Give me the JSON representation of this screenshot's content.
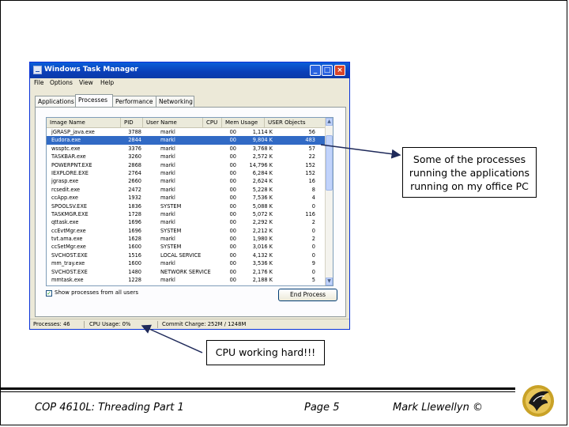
{
  "window": {
    "title": "Windows Task Manager",
    "menu": [
      "File",
      "Options",
      "View",
      "Help"
    ],
    "tabs": [
      "Applications",
      "Processes",
      "Performance",
      "Networking"
    ],
    "active_tab": "Processes",
    "columns": [
      "Image Name",
      "PID",
      "User Name",
      "CPU",
      "Mem Usage",
      "USER Objects"
    ],
    "rows": [
      {
        "name": "jGRASP_java.exe",
        "pid": "3788",
        "user": "markl",
        "cpu": "00",
        "mem": "1,114 K",
        "uo": "56"
      },
      {
        "name": "Eudora.exe",
        "pid": "2844",
        "user": "markl",
        "cpu": "00",
        "mem": "9,804 K",
        "uo": "483"
      },
      {
        "name": "wssptc.exe",
        "pid": "3376",
        "user": "markl",
        "cpu": "00",
        "mem": "3,768 K",
        "uo": "57"
      },
      {
        "name": "TASKBAR.exe",
        "pid": "3260",
        "user": "markl",
        "cpu": "00",
        "mem": "2,572 K",
        "uo": "22"
      },
      {
        "name": "POWERPNT.EXE",
        "pid": "2868",
        "user": "markl",
        "cpu": "00",
        "mem": "14,796 K",
        "uo": "152"
      },
      {
        "name": "IEXPLORE.EXE",
        "pid": "2764",
        "user": "markl",
        "cpu": "00",
        "mem": "6,284 K",
        "uo": "152"
      },
      {
        "name": "jgrasp.exe",
        "pid": "2660",
        "user": "markl",
        "cpu": "00",
        "mem": "2,624 K",
        "uo": "16"
      },
      {
        "name": "rcsedit.exe",
        "pid": "2472",
        "user": "markl",
        "cpu": "00",
        "mem": "5,228 K",
        "uo": "8"
      },
      {
        "name": "ccApp.exe",
        "pid": "1932",
        "user": "markl",
        "cpu": "00",
        "mem": "7,536 K",
        "uo": "4"
      },
      {
        "name": "SPOOLSV.EXE",
        "pid": "1836",
        "user": "SYSTEM",
        "cpu": "00",
        "mem": "5,088 K",
        "uo": "0"
      },
      {
        "name": "TASKMGR.EXE",
        "pid": "1728",
        "user": "markl",
        "cpu": "00",
        "mem": "5,072 K",
        "uo": "116"
      },
      {
        "name": "qttask.exe",
        "pid": "1696",
        "user": "markl",
        "cpu": "00",
        "mem": "2,292 K",
        "uo": "2"
      },
      {
        "name": "ccEvtMgr.exe",
        "pid": "1696",
        "user": "SYSTEM",
        "cpu": "00",
        "mem": "2,212 K",
        "uo": "0"
      },
      {
        "name": "tvt.ama.exe",
        "pid": "1628",
        "user": "markl",
        "cpu": "00",
        "mem": "1,980 K",
        "uo": "2"
      },
      {
        "name": "ccSetMgr.exe",
        "pid": "1600",
        "user": "SYSTEM",
        "cpu": "00",
        "mem": "3,016 K",
        "uo": "0"
      },
      {
        "name": "SVCHOST.EXE",
        "pid": "1516",
        "user": "LOCAL SERVICE",
        "cpu": "00",
        "mem": "4,132 K",
        "uo": "0"
      },
      {
        "name": "mm_tray.exe",
        "pid": "1600",
        "user": "markl",
        "cpu": "00",
        "mem": "3,536 K",
        "uo": "9"
      },
      {
        "name": "SVCHOST.EXE",
        "pid": "1480",
        "user": "NETWORK SERVICE",
        "cpu": "00",
        "mem": "2,176 K",
        "uo": "0"
      },
      {
        "name": "mmtask.exe",
        "pid": "1228",
        "user": "markl",
        "cpu": "00",
        "mem": "2,188 K",
        "uo": "5"
      }
    ],
    "selected_row": 1,
    "show_all_label": "Show processes from all users",
    "end_process_label": "End Process",
    "status": {
      "processes": "Processes: 46",
      "cpu": "CPU Usage: 0%",
      "commit": "Commit Charge: 252M / 1248M"
    }
  },
  "callout": {
    "lines": [
      "Some of the processes",
      "running the applications",
      "running on my office PC"
    ]
  },
  "cpu_callout": "CPU working hard!!!",
  "footer": {
    "course": "COP 4610L: Threading Part 1",
    "page": "Page 5",
    "author": "Mark Llewellyn ©"
  }
}
